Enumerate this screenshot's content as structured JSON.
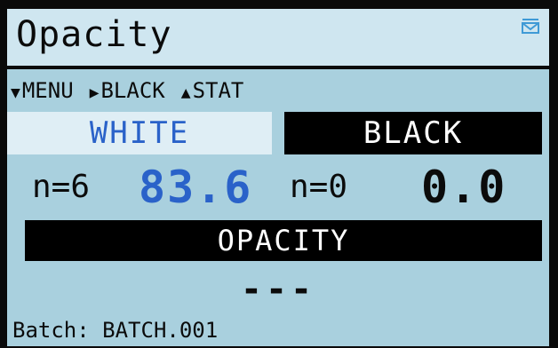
{
  "header": {
    "title": "Opacity",
    "icon": "email-icon"
  },
  "nav": {
    "menu": "MENU",
    "black": "BLACK",
    "stat": "STAT"
  },
  "columns": {
    "white_label": "WHITE",
    "black_label": "BLACK"
  },
  "readings": {
    "white_n": "n=6",
    "white_value": "83.6",
    "black_n": "n=0",
    "black_value": "0.0"
  },
  "result": {
    "label": "OPACITY",
    "value": "---"
  },
  "batch": "Batch: BATCH.001",
  "colors": {
    "screen_bg": "#a9d0de",
    "accent_blue": "#2a62c9"
  }
}
